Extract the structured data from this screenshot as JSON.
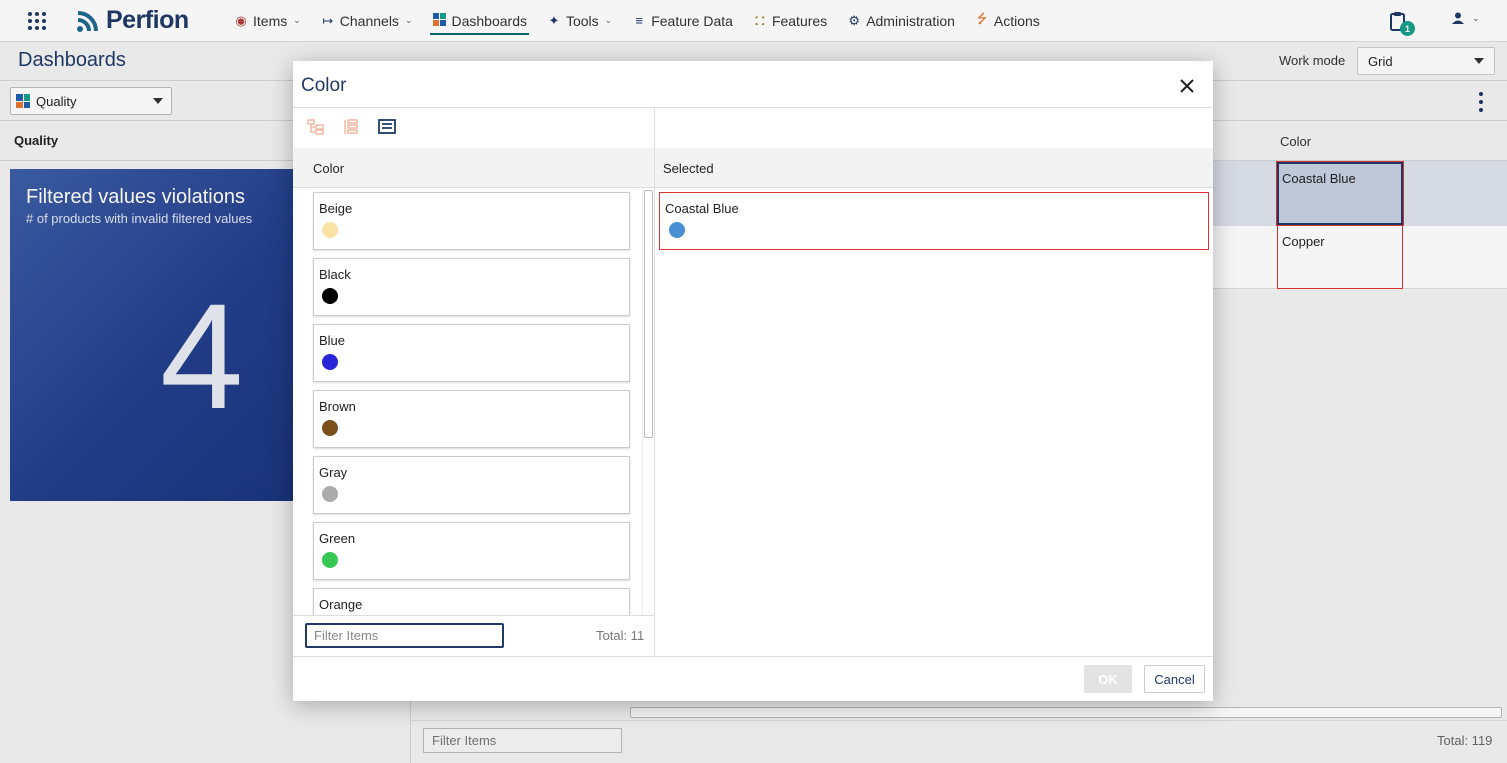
{
  "nav": {
    "brand": "Perfion",
    "items": [
      {
        "label": "Items",
        "icon": "cube-icon",
        "caret": true
      },
      {
        "label": "Channels",
        "icon": "channel-arrow-icon",
        "caret": true
      },
      {
        "label": "Dashboards",
        "icon": "dashboard-icon",
        "caret": false,
        "active": true
      },
      {
        "label": "Tools",
        "icon": "wrench-icon",
        "caret": true
      },
      {
        "label": "Feature Data",
        "icon": "list-indent-icon",
        "caret": false
      },
      {
        "label": "Features",
        "icon": "database-icon",
        "caret": false
      },
      {
        "label": "Administration",
        "icon": "gear-icon",
        "caret": false
      },
      {
        "label": "Actions",
        "icon": "lightning-icon",
        "caret": false
      }
    ],
    "clipboard_badge": "1"
  },
  "page": {
    "title": "Dashboards",
    "work_mode_label": "Work mode",
    "work_mode_value": "Grid",
    "dashboard_select": "Quality",
    "section_label": "Quality"
  },
  "tile": {
    "title": "Filtered values violations",
    "subtitle": "# of products with invalid filtered values",
    "value": "4"
  },
  "background_grid": {
    "column_header": "Color",
    "cells": [
      "Coastal Blue",
      "Copper"
    ],
    "filter_placeholder": "Filter Items",
    "total": "Total: 119"
  },
  "modal": {
    "title": "Color",
    "left_header": "Color",
    "right_header": "Selected",
    "options": [
      {
        "label": "Beige",
        "color": "#fbe3a6"
      },
      {
        "label": "Black",
        "color": "#000000"
      },
      {
        "label": "Blue",
        "color": "#2a24d8"
      },
      {
        "label": "Brown",
        "color": "#7a4f1c"
      },
      {
        "label": "Gray",
        "color": "#ababab"
      },
      {
        "label": "Green",
        "color": "#36c754"
      },
      {
        "label": "Orange",
        "color": "#f08a24"
      }
    ],
    "selected": [
      {
        "label": "Coastal Blue",
        "color": "#4a8fd4"
      }
    ],
    "filter_placeholder": "Filter Items",
    "total": "Total: 11",
    "ok_label": "OK",
    "cancel_label": "Cancel"
  }
}
